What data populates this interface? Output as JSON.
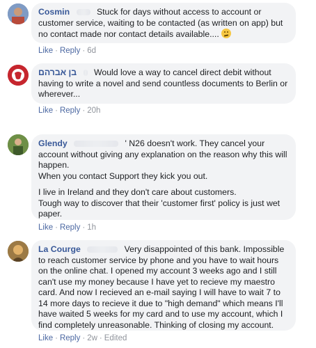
{
  "comments": [
    {
      "author": "Cosmin",
      "paragraphs": [
        "Stuck for days without access to account or customer service, waiting to be contacted (as written on app) but no contact made nor contact details available.... "
      ],
      "like": "Like",
      "reply": "Reply",
      "time": "6d",
      "edited": ""
    },
    {
      "author": "בן אברהם",
      "paragraphs": [
        "Would love a way to cancel direct debit without having to write a novel and send countless documents to Berlin or wherever..."
      ],
      "like": "Like",
      "reply": "Reply",
      "time": "20h",
      "edited": ""
    },
    {
      "author": "Glendy",
      "paragraphs": [
        "' N26 doesn't work. They cancel your account without giving any explanation on the reason why this will happen.\nWhen you contact Support they kick you out.",
        "I live in Ireland and they don't care about customers.\nTough way to discover that their 'customer first' policy is just wet paper."
      ],
      "like": "Like",
      "reply": "Reply",
      "time": "1h",
      "edited": ""
    },
    {
      "author": "La Courge",
      "paragraphs": [
        "Very disappointed of this bank. Impossible to reach customer service by phone and you have to wait hours on the online chat. I opened my account 3 weeks ago and I still can't use my money because I have yet to recieve my maestro card. And now I recieved an e-mail saying I will have to wait 7 to 14 more days to recieve it due to \"high demand\" which means I'll have waited 5 weeks for my card and to use my account, which I find completely unreasonable. Thinking of closing my account."
      ],
      "like": "Like",
      "reply": "Reply",
      "time": "2w",
      "edited": "Edited"
    }
  ],
  "colors": {
    "author": "#385898",
    "bubble": "#f2f3f5",
    "meta": "#90949c"
  },
  "icons": [
    "confused-face-emoji",
    "avatar"
  ]
}
